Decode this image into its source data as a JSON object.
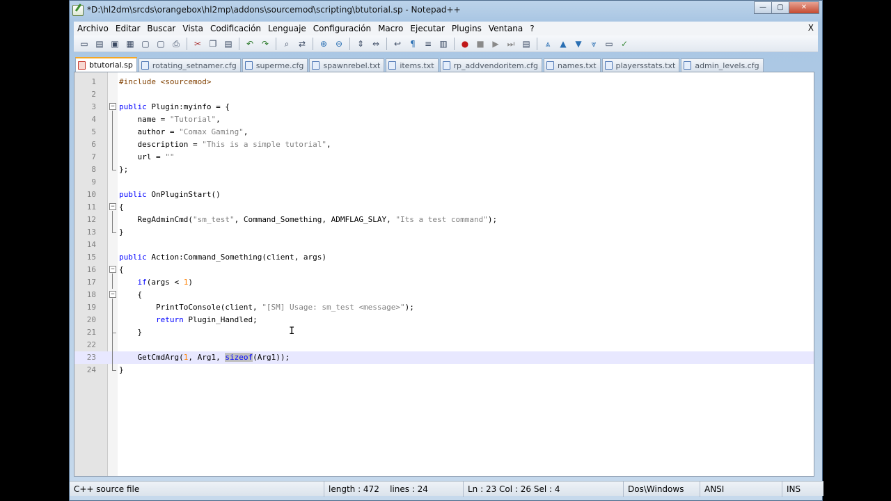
{
  "window": {
    "title": "*D:\\hl2dm\\srcds\\orangebox\\hl2mp\\addons\\sourcemod\\scripting\\btutorial.sp - Notepad++",
    "minimize": "—",
    "maximize": "▢",
    "close": "✕"
  },
  "menu": {
    "items": [
      "Archivo",
      "Editar",
      "Buscar",
      "Vista",
      "Codificación",
      "Lenguaje",
      "Configuración",
      "Macro",
      "Ejecutar",
      "Plugins",
      "Ventana",
      "?"
    ],
    "close_label": "X"
  },
  "toolbar": {
    "groups": [
      [
        "new-file-icon",
        "open-file-icon",
        "save-icon",
        "save-all-icon",
        "close-file-icon",
        "close-all-icon",
        "print-icon"
      ],
      [
        "cut-icon",
        "copy-icon",
        "paste-icon"
      ],
      [
        "undo-icon",
        "redo-icon"
      ],
      [
        "find-icon",
        "replace-icon"
      ],
      [
        "zoom-in-icon",
        "zoom-out-icon"
      ],
      [
        "sync-v-icon",
        "sync-h-icon"
      ],
      [
        "word-wrap-icon",
        "show-all-chars-icon",
        "indent-guide-icon",
        "doc-map-icon"
      ],
      [
        "record-macro-icon",
        "stop-macro-icon",
        "play-macro-icon",
        "play-multiple-icon",
        "save-macro-icon"
      ],
      [
        "collapse-icon",
        "up-icon",
        "down-icon",
        "expand-icon",
        "folder-icon",
        "spellcheck-icon"
      ]
    ]
  },
  "tabs": [
    {
      "label": "btutorial.sp",
      "active": true
    },
    {
      "label": "rotating_setnamer.cfg",
      "active": false
    },
    {
      "label": "superme.cfg",
      "active": false
    },
    {
      "label": "spawnrebel.txt",
      "active": false
    },
    {
      "label": "items.txt",
      "active": false
    },
    {
      "label": "rp_addvendoritem.cfg",
      "active": false
    },
    {
      "label": "names.txt",
      "active": false
    },
    {
      "label": "playersstats.txt",
      "active": false
    },
    {
      "label": "admin_levels.cfg",
      "active": false
    }
  ],
  "editor": {
    "current_line": 23,
    "lines": [
      {
        "n": "1",
        "fold": "",
        "tokens": [
          [
            "pp",
            "#include <sourcemod>"
          ]
        ]
      },
      {
        "n": "2",
        "fold": "",
        "tokens": []
      },
      {
        "n": "3",
        "fold": "open",
        "tokens": [
          [
            "kw",
            "public"
          ],
          [
            "",
            " Plugin:myinfo = {"
          ]
        ]
      },
      {
        "n": "4",
        "fold": "mid",
        "tokens": [
          [
            "",
            "    name = "
          ],
          [
            "str",
            "\"Tutorial\""
          ],
          [
            "",
            ","
          ]
        ]
      },
      {
        "n": "5",
        "fold": "mid",
        "tokens": [
          [
            "",
            "    author = "
          ],
          [
            "str",
            "\"Comax Gaming\""
          ],
          [
            "",
            ","
          ]
        ]
      },
      {
        "n": "6",
        "fold": "mid",
        "tokens": [
          [
            "",
            "    description = "
          ],
          [
            "str",
            "\"This is a simple tutorial\""
          ],
          [
            "",
            ","
          ]
        ]
      },
      {
        "n": "7",
        "fold": "mid",
        "tokens": [
          [
            "",
            "    url = "
          ],
          [
            "str",
            "\"\""
          ]
        ]
      },
      {
        "n": "8",
        "fold": "end",
        "tokens": [
          [
            "",
            "};"
          ]
        ]
      },
      {
        "n": "9",
        "fold": "",
        "tokens": []
      },
      {
        "n": "10",
        "fold": "",
        "tokens": [
          [
            "kw",
            "public"
          ],
          [
            "",
            " OnPluginStart()"
          ]
        ]
      },
      {
        "n": "11",
        "fold": "open",
        "tokens": [
          [
            "",
            "{"
          ]
        ]
      },
      {
        "n": "12",
        "fold": "mid",
        "tokens": [
          [
            "",
            "    RegAdminCmd("
          ],
          [
            "str",
            "\"sm_test\""
          ],
          [
            "",
            ", Command_Something, ADMFLAG_SLAY, "
          ],
          [
            "str",
            "\"Its a test command\""
          ],
          [
            "",
            ");"
          ]
        ]
      },
      {
        "n": "13",
        "fold": "end",
        "tokens": [
          [
            "",
            "}"
          ]
        ]
      },
      {
        "n": "14",
        "fold": "",
        "tokens": []
      },
      {
        "n": "15",
        "fold": "",
        "tokens": [
          [
            "kw",
            "public"
          ],
          [
            "",
            " Action:Command_Something(client, args)"
          ]
        ]
      },
      {
        "n": "16",
        "fold": "open",
        "tokens": [
          [
            "",
            "{"
          ]
        ]
      },
      {
        "n": "17",
        "fold": "mid",
        "tokens": [
          [
            "",
            "    "
          ],
          [
            "kw",
            "if"
          ],
          [
            "",
            "(args < "
          ],
          [
            "num",
            "1"
          ],
          [
            "",
            ")"
          ]
        ]
      },
      {
        "n": "18",
        "fold": "open2",
        "tokens": [
          [
            "",
            "    {"
          ]
        ]
      },
      {
        "n": "19",
        "fold": "mid",
        "tokens": [
          [
            "",
            "        PrintToConsole(client, "
          ],
          [
            "str",
            "\"[SM] Usage: sm_test <message>\""
          ],
          [
            "",
            ");"
          ]
        ]
      },
      {
        "n": "20",
        "fold": "mid",
        "tokens": [
          [
            "",
            "        "
          ],
          [
            "kw",
            "return"
          ],
          [
            "",
            " Plugin_Handled;"
          ]
        ]
      },
      {
        "n": "21",
        "fold": "end2",
        "tokens": [
          [
            "",
            "    }"
          ]
        ]
      },
      {
        "n": "22",
        "fold": "mid",
        "tokens": []
      },
      {
        "n": "23",
        "fold": "mid",
        "tokens": [
          [
            "",
            "    GetCmdArg("
          ],
          [
            "num",
            "1"
          ],
          [
            "",
            ", Arg1, "
          ],
          [
            "kwsel",
            "sizeof"
          ],
          [
            "",
            "(Arg1));"
          ]
        ]
      },
      {
        "n": "24",
        "fold": "end",
        "tokens": [
          [
            "",
            "}"
          ]
        ]
      }
    ]
  },
  "status": {
    "file_type": "C++ source file",
    "length": "length : 472",
    "lines": "lines : 24",
    "position": "Ln : 23   Col : 26   Sel : 4",
    "eol": "Dos\\Windows",
    "encoding": "ANSI",
    "mode": "INS"
  }
}
